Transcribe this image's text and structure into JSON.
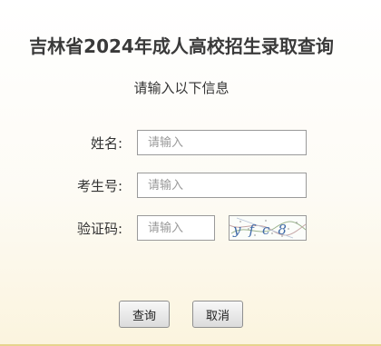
{
  "header": {
    "title": "吉林省2024年成人高校招生录取查询"
  },
  "form": {
    "subtitle": "请输入以下信息",
    "name": {
      "label": "姓名:",
      "placeholder": "请输入",
      "value": ""
    },
    "exam_number": {
      "label": "考生号:",
      "placeholder": "请输入",
      "value": ""
    },
    "verification_code": {
      "label": "验证码:",
      "placeholder": "请输入",
      "value": ""
    },
    "captcha_text": "yfc8"
  },
  "buttons": {
    "query": "查询",
    "cancel": "取消"
  },
  "colors": {
    "border": "#9a9a9a",
    "bottom_accent": "#e6d48e",
    "captcha_ink": "#3f6aa8"
  }
}
